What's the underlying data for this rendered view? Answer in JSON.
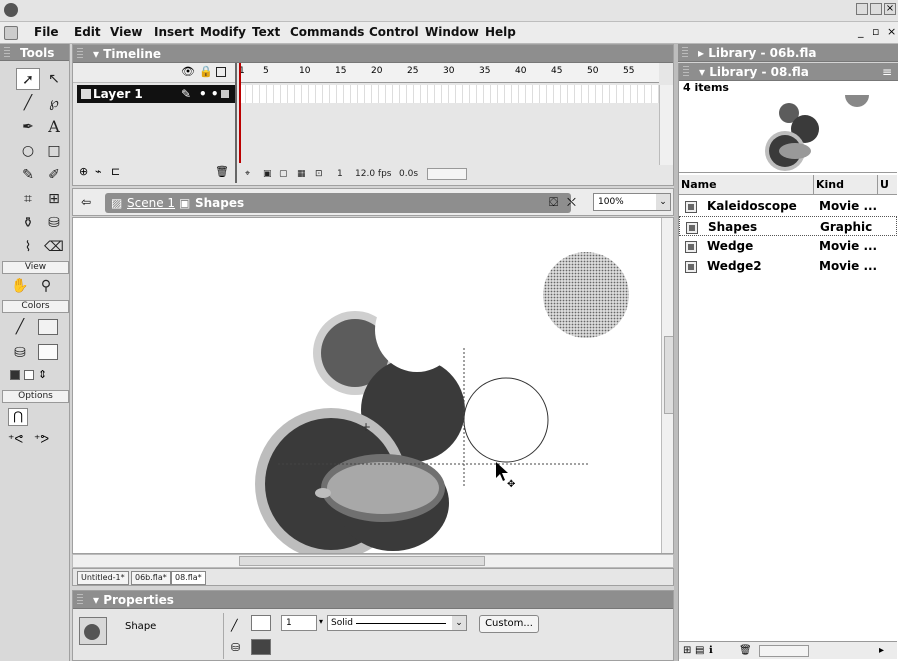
{
  "window": {
    "menu": [
      "File",
      "Edit",
      "View",
      "Insert",
      "Modify",
      "Text",
      "Commands",
      "Control",
      "Window",
      "Help"
    ]
  },
  "tools": {
    "title": "Tools",
    "icons": [
      "arrow-tool",
      "subselect-tool",
      "line-tool",
      "lasso-tool",
      "pen-tool",
      "text-tool",
      "oval-tool",
      "rectangle-tool",
      "pencil-tool",
      "brush-tool",
      "free-transform-tool",
      "fill-transform-tool",
      "ink-bottle-tool",
      "paint-bucket-tool",
      "eyedropper-tool",
      "eraser-tool"
    ],
    "view_label": "View",
    "colors_label": "Colors",
    "options_label": "Options"
  },
  "timeline": {
    "title": "Timeline",
    "layer_name": "Layer 1",
    "frame_ticks": [
      "1",
      "5",
      "10",
      "15",
      "20",
      "25",
      "30",
      "35",
      "40",
      "45",
      "50",
      "55"
    ],
    "current_frame": "1",
    "fps": "12.0 fps",
    "time": "0.0s"
  },
  "editbar": {
    "scene": "Scene 1",
    "symbol": "Shapes",
    "zoom": "100%"
  },
  "doc_tabs": [
    "Untitled-1*",
    "06b.fla*",
    "08.fla*"
  ],
  "properties": {
    "title": "Properties",
    "type": "Shape",
    "stroke_height": "1",
    "stroke_style": "Solid",
    "custom_button": "Custom..."
  },
  "library_collapsed": {
    "title": "Library - 06b.fla"
  },
  "library": {
    "title": "Library - 08.fla",
    "count": "4 items",
    "columns": {
      "name": "Name",
      "kind": "Kind",
      "use": "U"
    },
    "items": [
      {
        "name": "Kaleidoscope",
        "kind": "Movie ..."
      },
      {
        "name": "Shapes",
        "kind": "Graphic"
      },
      {
        "name": "Wedge",
        "kind": "Movie ..."
      },
      {
        "name": "Wedge2",
        "kind": "Movie ..."
      }
    ]
  },
  "colors": {
    "panel_header": "#8e8e8e",
    "stage": "#ffffff",
    "dark_shape": "#3a3a3a",
    "light_ring": "#bdbdbd",
    "mid_shape": "#8a8a8a"
  }
}
